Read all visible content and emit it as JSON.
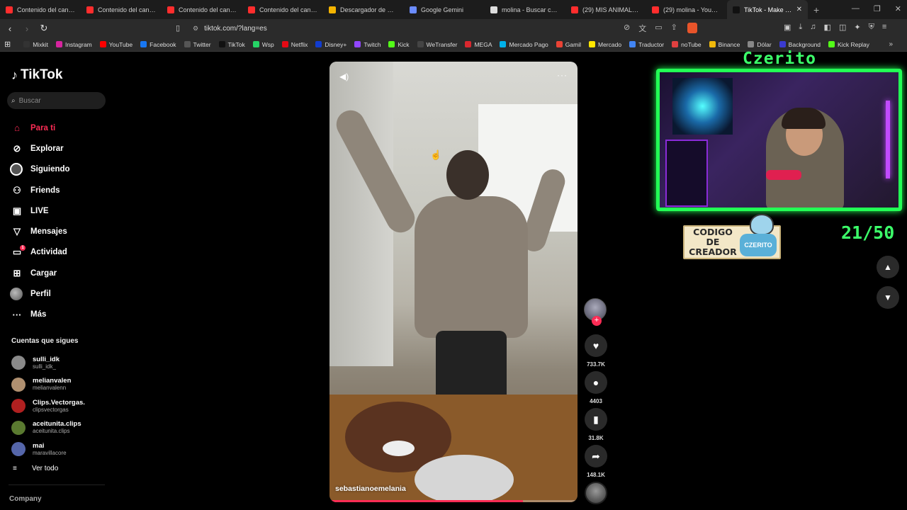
{
  "browser": {
    "tabs": [
      {
        "title": "Contenido del canal -",
        "color": "#ff2d2d"
      },
      {
        "title": "Contenido del canal -",
        "color": "#ff2d2d"
      },
      {
        "title": "Contenido del canal -",
        "color": "#ff2d2d"
      },
      {
        "title": "Contenido del canal -",
        "color": "#ff2d2d"
      },
      {
        "title": "Descargador de Miniat",
        "color": "#f4b400"
      },
      {
        "title": "Google Gemini",
        "color": "#6b8cff"
      },
      {
        "title": "molina - Buscar con Go",
        "color": "#dddddd"
      },
      {
        "title": "(29) MIS ANIMALES H",
        "color": "#ff2d2d"
      },
      {
        "title": "(29) molina - YouTube",
        "color": "#ff2d2d"
      },
      {
        "title": "TikTok - Make Your",
        "color": "#111111",
        "active": true
      }
    ],
    "new_tab": "+",
    "url": "tiktok.com/?lang=es",
    "bookmarks": [
      {
        "label": "Mixkit",
        "color": "#333"
      },
      {
        "label": "Instagram",
        "color": "#d6249f"
      },
      {
        "label": "YouTube",
        "color": "#ff0000"
      },
      {
        "label": "Facebook",
        "color": "#1877f2"
      },
      {
        "label": "Twitter",
        "color": "#555"
      },
      {
        "label": "TikTok",
        "color": "#111"
      },
      {
        "label": "Wsp",
        "color": "#25d366"
      },
      {
        "label": "Netflix",
        "color": "#e50914"
      },
      {
        "label": "Disney+",
        "color": "#113ccf"
      },
      {
        "label": "Twitch",
        "color": "#9146ff"
      },
      {
        "label": "Kick",
        "color": "#53fc18"
      },
      {
        "label": "WeTransfer",
        "color": "#444"
      },
      {
        "label": "MEGA",
        "color": "#d9272e"
      },
      {
        "label": "Mercado Pago",
        "color": "#00b1ea"
      },
      {
        "label": "Gamil",
        "color": "#ea4335"
      },
      {
        "label": "Mercado",
        "color": "#ffe600"
      },
      {
        "label": "Traductor",
        "color": "#4285f4"
      },
      {
        "label": "noTube",
        "color": "#e04040"
      },
      {
        "label": "Binance",
        "color": "#f0b90b"
      },
      {
        "label": "Dólar",
        "color": "#888"
      },
      {
        "label": "Background",
        "color": "#3b3bd1"
      },
      {
        "label": "Kick Replay",
        "color": "#53fc18"
      }
    ]
  },
  "tiktok": {
    "brand": "TikTok",
    "search_placeholder": "Buscar",
    "menu": [
      {
        "label": "Para ti",
        "icon": "home-icon",
        "glyph": "⌂",
        "active": true
      },
      {
        "label": "Explorar",
        "icon": "compass-icon",
        "glyph": "⊘"
      },
      {
        "label": "Siguiendo",
        "icon": "following-icon",
        "glyph": "ring"
      },
      {
        "label": "Friends",
        "icon": "friends-icon",
        "glyph": "⚇"
      },
      {
        "label": "LIVE",
        "icon": "live-icon",
        "glyph": "▣"
      },
      {
        "label": "Mensajes",
        "icon": "messages-icon",
        "glyph": "▽"
      },
      {
        "label": "Actividad",
        "icon": "activity-icon",
        "glyph": "▭",
        "badge": "1"
      },
      {
        "label": "Cargar",
        "icon": "upload-icon",
        "glyph": "⊞"
      },
      {
        "label": "Perfil",
        "icon": "profile-icon",
        "glyph": "avatar"
      },
      {
        "label": "Más",
        "icon": "more-icon",
        "glyph": "···"
      }
    ],
    "following_title": "Cuentas que sigues",
    "following": [
      {
        "name": "sulli_idk",
        "handle": "sulli_idk_",
        "color": "#8a8a8a"
      },
      {
        "name": "melianvalen",
        "handle": "melianvalenn",
        "color": "#b09070"
      },
      {
        "name": "Clips.Vectorgas.",
        "handle": "clipsvectorgas",
        "color": "#b02020"
      },
      {
        "name": "aceitunita.clips",
        "handle": "aceitunita.clips",
        "color": "#5a7a30"
      },
      {
        "name": "mai",
        "handle": "maravillacore",
        "color": "#5566aa"
      }
    ],
    "see_all": "Ver todo",
    "company": "Company"
  },
  "video": {
    "author": "sebastianoemelania",
    "progress": 0.78,
    "likes": "733.7K",
    "comments": "4403",
    "saves": "31.8K",
    "shares": "148.1K"
  },
  "overlay": {
    "streamer": "Czerito",
    "codigo_line1": "CODIGO",
    "codigo_line2": "DE CREADOR",
    "codigo_logo": "CZERITO",
    "counter": "21/50"
  }
}
